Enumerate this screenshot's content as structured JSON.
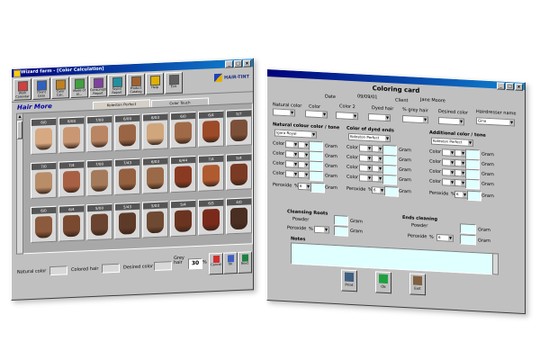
{
  "left_window": {
    "title": "Wizard farm - [Color Calculation]",
    "window_buttons": [
      "_",
      "□",
      "x"
    ],
    "toolbar": [
      {
        "label": "Work Calendar",
        "icon": "calendar-icon"
      },
      {
        "label": "Client Data",
        "icon": "client-icon"
      },
      {
        "label": "Color Calc.",
        "icon": "palette-icon"
      },
      {
        "label": "Mode of Al...",
        "icon": "mode-icon"
      },
      {
        "label": "Consumption Report",
        "icon": "report-icon"
      },
      {
        "label": "Stylist Report",
        "icon": "stylist-icon"
      },
      {
        "label": "Product Catalog",
        "icon": "catalog-icon"
      },
      {
        "label": "Help",
        "icon": "help-icon"
      },
      {
        "label": "Exit",
        "icon": "exit-icon"
      }
    ],
    "brand": "HAIR-TINT",
    "section_title": "Hair More",
    "tabs": [
      "Koleston Perfect",
      "Color Touch"
    ],
    "swatch_rows": [
      [
        {
          "code": "8/0",
          "color": "#d6a982"
        },
        {
          "code": "8/00",
          "color": "#c99773"
        },
        {
          "code": "7/00",
          "color": "#b98563"
        },
        {
          "code": "6/00",
          "color": "#9a6545"
        },
        {
          "code": "8/03",
          "color": "#d0a67c"
        },
        {
          "code": "6/0",
          "color": "#a06a48"
        },
        {
          "code": "6/4",
          "color": "#9c4a28"
        },
        {
          "code": "5/7",
          "color": "#7c5038"
        }
      ],
      [
        {
          "code": "7/0",
          "color": "#b98d68"
        },
        {
          "code": "7/4",
          "color": "#a86044"
        },
        {
          "code": "7/00",
          "color": "#a57a5a"
        },
        {
          "code": "7/43",
          "color": "#946040"
        },
        {
          "code": "6/03",
          "color": "#9a6a48"
        },
        {
          "code": "6/44",
          "color": "#8a3a22"
        },
        {
          "code": "7/4",
          "color": "#b05a30"
        },
        {
          "code": "5/4",
          "color": "#7a3a24"
        }
      ],
      [
        {
          "code": "6/0",
          "color": "#8c5a3c"
        },
        {
          "code": "6/4",
          "color": "#7a4a30"
        },
        {
          "code": "5/00",
          "color": "#6a4430"
        },
        {
          "code": "5/43",
          "color": "#5e3a28"
        },
        {
          "code": "5/03",
          "color": "#6e4a32"
        },
        {
          "code": "5/4",
          "color": "#6a3420"
        },
        {
          "code": "6/5",
          "color": "#7a2a1a"
        },
        {
          "code": "4/0",
          "color": "#4a2e22"
        }
      ]
    ],
    "bottom": {
      "natural_color_label": "Natural color",
      "natural_color_value": "",
      "colored_hair_label": "Colored hair",
      "colored_hair_value": "",
      "desired_color_label": "Desired color",
      "desired_color_value": "",
      "grey_hair_label": "Grey hair",
      "grey_percent": "30",
      "percent_sign": "%",
      "buttons": [
        "Cancel",
        "Ok",
        "Next"
      ]
    }
  },
  "right_window": {
    "title": "Coloring card",
    "window_buttons": [
      "_",
      "□",
      "x"
    ],
    "header_labels": {
      "date": "Date",
      "date_value": "09/09/01",
      "client": "Client",
      "client_value": "Jane Moore",
      "natural_color": "Natural color",
      "color_label": "Color",
      "color2": "Color 2",
      "dyed_hair": "Dyed hair",
      "grey_hair_percent": "% grey hair",
      "desired_color": "Desired color",
      "hairdresser": "Hairdresser name",
      "hairdresser_value": "Gina"
    },
    "sections": {
      "natural": {
        "title": "Natural colour color / tone",
        "brand": "Igora Royal"
      },
      "dyed": {
        "title": "Color of dyed ends",
        "brand": "Koleston Perfect"
      },
      "additional": {
        "title": "Additional color / tone",
        "brand": "Koleston Perfect"
      }
    },
    "row_labels": [
      "Color",
      "Color",
      "Color",
      "Color"
    ],
    "grams_label": "Gram",
    "peroxide_label": "Peroxide",
    "percent_sign": "%",
    "peroxide_value": "6",
    "clearing_title": "Cleansing Roots",
    "ends_title": "Ends cleaning",
    "powder_label": "Powder",
    "notes_label": "Notes",
    "buttons": [
      {
        "label": "Print",
        "icon": "print-icon"
      },
      {
        "label": "Ok",
        "icon": "check-icon"
      },
      {
        "label": "Exit",
        "icon": "exit-icon"
      }
    ]
  }
}
